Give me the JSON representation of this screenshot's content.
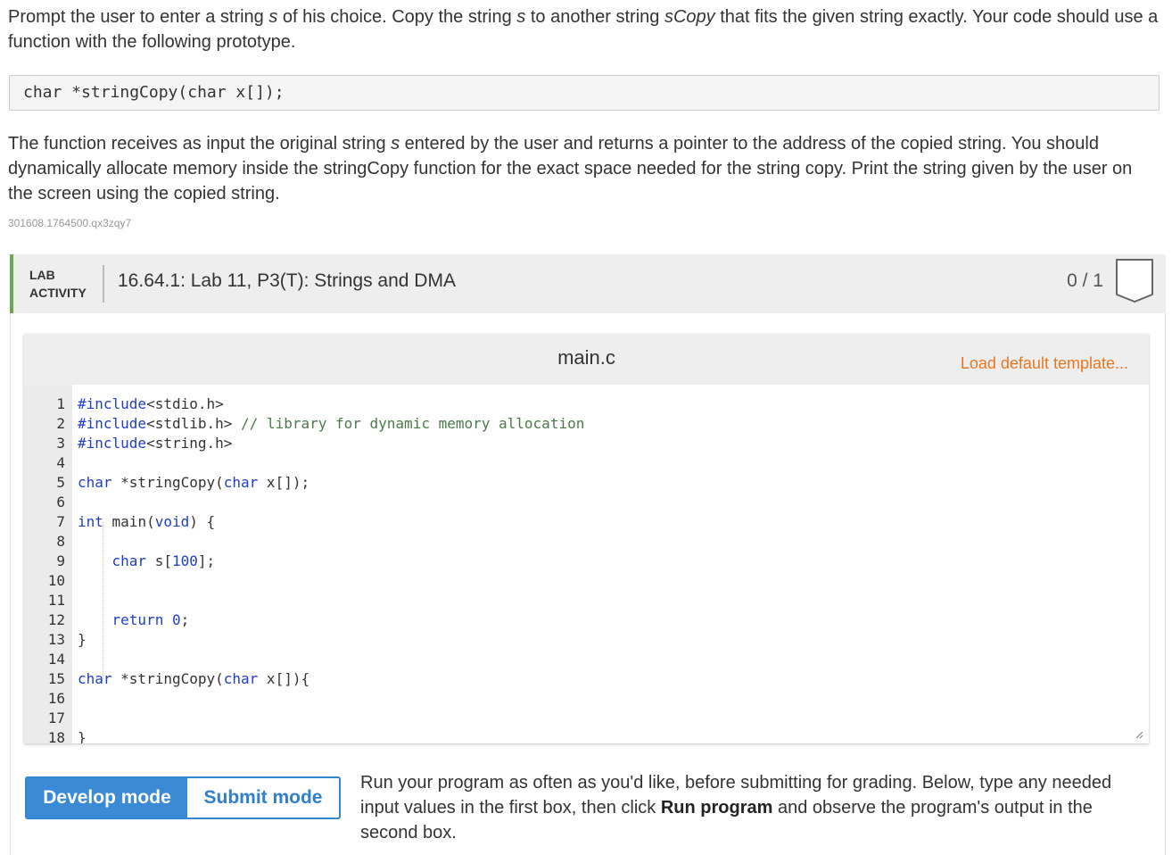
{
  "prompt": {
    "p1": [
      {
        "t": "Prompt the user to enter a string "
      },
      {
        "t": "s",
        "i": true
      },
      {
        "t": " of his choice. Copy the string "
      },
      {
        "t": "s",
        "i": true
      },
      {
        "t": " to another string "
      },
      {
        "t": "sCopy",
        "i": true
      },
      {
        "t": " that fits the given string exactly. Your code should use a function with the following prototype."
      }
    ],
    "prototype": "char *stringCopy(char x[]);",
    "p2": [
      {
        "t": "The function receives as input the original string "
      },
      {
        "t": "s",
        "i": true
      },
      {
        "t": " entered by the user and returns a pointer to the address of the copied string. You should dynamically allocate memory inside the stringCopy function for the exact space needed for the string copy. Print the string given by the user on the screen using the copied string."
      }
    ],
    "identifier": "301608.1764500.qx3zqy7"
  },
  "lab": {
    "tag_line1": "LAB",
    "tag_line2": "ACTIVITY",
    "title": "16.64.1: Lab 11, P3(T): Strings and DMA",
    "score": "0 / 1",
    "badge_icon": "completion-badge-icon"
  },
  "editor": {
    "file_name": "main.c",
    "load_template_label": "Load default template...",
    "lines": [
      [
        {
          "t": "#include",
          "c": "kw"
        },
        {
          "t": "<stdio.h>"
        }
      ],
      [
        {
          "t": "#include",
          "c": "kw"
        },
        {
          "t": "<stdlib.h> "
        },
        {
          "t": "// library for dynamic memory allocation",
          "c": "cm"
        }
      ],
      [
        {
          "t": "#include",
          "c": "kw"
        },
        {
          "t": "<string.h>"
        }
      ],
      [],
      [
        {
          "t": "char",
          "c": "kw"
        },
        {
          "t": " *stringCopy("
        },
        {
          "t": "char",
          "c": "kw"
        },
        {
          "t": " x[]);"
        }
      ],
      [],
      [
        {
          "t": "int",
          "c": "kw"
        },
        {
          "t": " main("
        },
        {
          "t": "void",
          "c": "kw"
        },
        {
          "t": ") {"
        }
      ],
      [],
      [
        {
          "t": "    "
        },
        {
          "t": "char",
          "c": "kw"
        },
        {
          "t": " s["
        },
        {
          "t": "100",
          "c": "num"
        },
        {
          "t": "];"
        }
      ],
      [],
      [],
      [
        {
          "t": "    "
        },
        {
          "t": "return",
          "c": "kw"
        },
        {
          "t": " "
        },
        {
          "t": "0",
          "c": "num"
        },
        {
          "t": ";"
        }
      ],
      [
        {
          "t": "}"
        }
      ],
      [],
      [
        {
          "t": "char",
          "c": "kw"
        },
        {
          "t": " *stringCopy("
        },
        {
          "t": "char",
          "c": "kw"
        },
        {
          "t": " x[]){"
        }
      ],
      [],
      [],
      [
        {
          "t": "}"
        }
      ]
    ]
  },
  "modes": {
    "develop_label": "Develop mode",
    "submit_label": "Submit mode",
    "active": "develop"
  },
  "run_instructions": [
    {
      "t": "Run your program as often as you'd like, before submitting for grading. Below, type any needed input values in the first box, then click "
    },
    {
      "t": "Run program",
      "b": true
    },
    {
      "t": " and observe the program's output in the second box."
    }
  ]
}
